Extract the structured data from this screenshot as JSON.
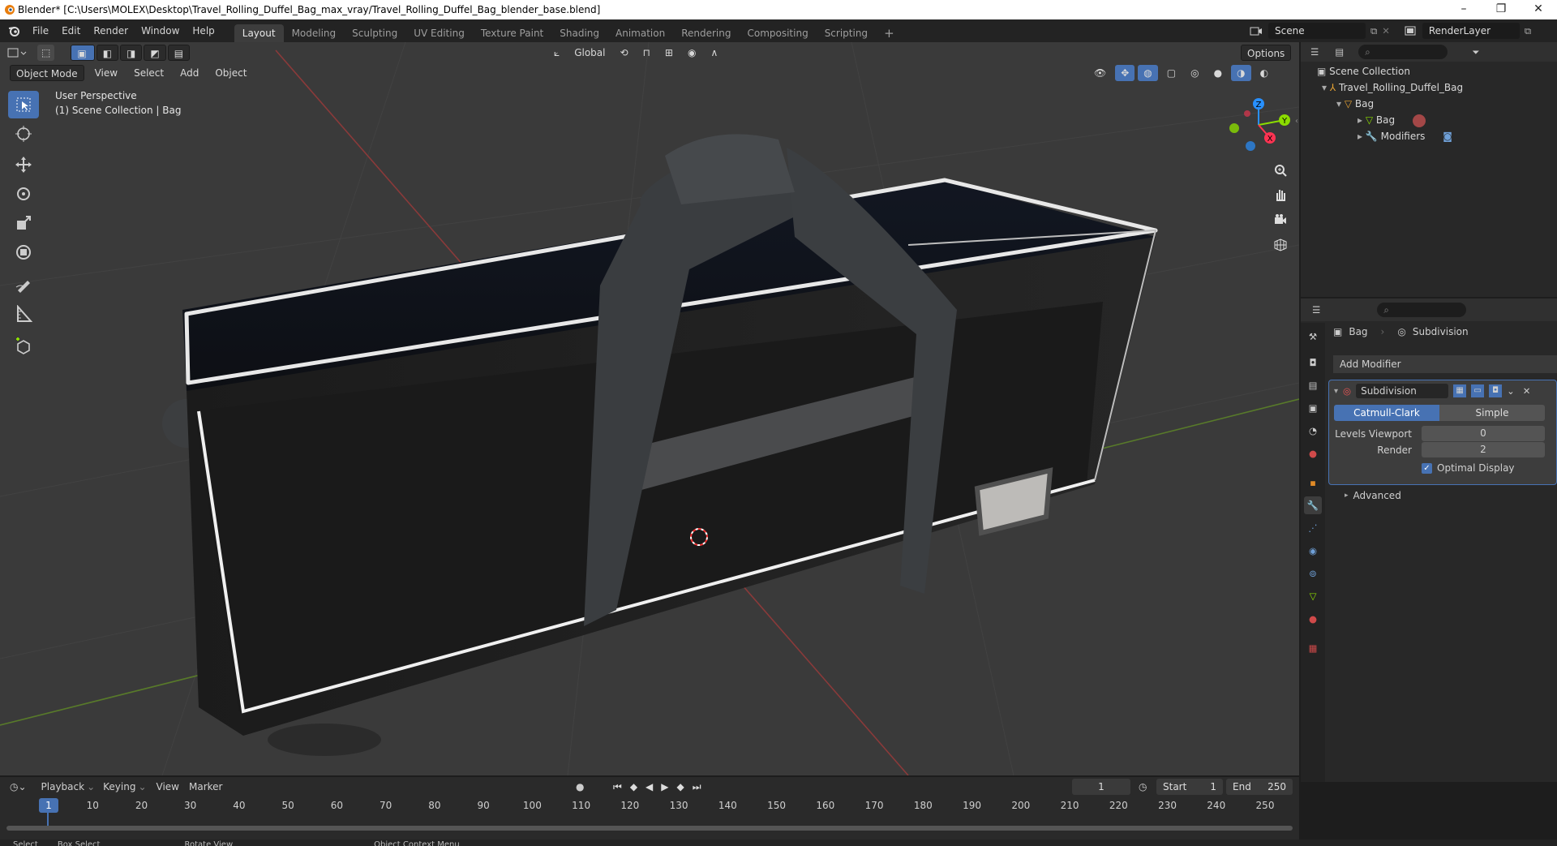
{
  "window": {
    "title": "Blender* [C:\\Users\\MOLEX\\Desktop\\Travel_Rolling_Duffel_Bag_max_vray/Travel_Rolling_Duffel_Bag_blender_base.blend]",
    "minimize": "–",
    "restore": "❐",
    "close": "✕"
  },
  "menu": [
    "File",
    "Edit",
    "Render",
    "Window",
    "Help"
  ],
  "workspaces": [
    "Layout",
    "Modeling",
    "Sculpting",
    "UV Editing",
    "Texture Paint",
    "Shading",
    "Animation",
    "Rendering",
    "Compositing",
    "Scripting"
  ],
  "workspace_add": "+",
  "scene": {
    "scene_name": "Scene",
    "view_layer": "RenderLayer"
  },
  "viewport": {
    "mode": "Object Mode",
    "menus": [
      "View",
      "Select",
      "Add",
      "Object"
    ],
    "transform_orientation": "Global",
    "options": "Options",
    "overlay_title": "User Perspective",
    "overlay_subtitle": "(1) Scene Collection | Bag",
    "gizmo_axes": [
      "X",
      "Y",
      "Z"
    ]
  },
  "outliner": {
    "rows": [
      {
        "label": "Scene Collection",
        "icon": "collection-icon"
      },
      {
        "label": "Travel_Rolling_Duffel_Bag",
        "icon": "empty-icon"
      },
      {
        "label": "Bag",
        "icon": "object-icon"
      },
      {
        "label": "Bag",
        "icon": "mesh-icon"
      },
      {
        "label": "Modifiers",
        "icon": "wrench-icon"
      }
    ]
  },
  "properties": {
    "breadcrumb_object": "Bag",
    "breadcrumb_modifier": "Subdivision",
    "add_modifier": "Add Modifier",
    "modifier_name": "Subdivision",
    "type_options": [
      "Catmull-Clark",
      "Simple"
    ],
    "selected_type": "Catmull-Clark",
    "fields": [
      {
        "label": "Levels Viewport",
        "value": "0"
      },
      {
        "label": "Render",
        "value": "2"
      }
    ],
    "optimal_display": "Optimal Display",
    "optimal_display_checked": true,
    "advanced": "Advanced"
  },
  "timeline": {
    "menus": [
      "Playback",
      "Keying",
      "View",
      "Marker"
    ],
    "current_frame": "1",
    "start_label": "Start",
    "start": "1",
    "end_label": "End",
    "end": "250",
    "ticks": [
      "1",
      "10",
      "20",
      "30",
      "40",
      "50",
      "60",
      "70",
      "80",
      "90",
      "100",
      "110",
      "120",
      "130",
      "140",
      "150",
      "160",
      "170",
      "180",
      "190",
      "200",
      "210",
      "220",
      "230",
      "240",
      "250"
    ]
  },
  "status": [
    "Select",
    "Box Select",
    "Rotate View",
    "Object Context Menu"
  ],
  "colors": {
    "accent": "#4772b3",
    "viewport_bg": "#3a3a3a",
    "panel_bg": "#282828",
    "axis_x": "#ff3352",
    "axis_y": "#8bdc00",
    "axis_z": "#2890ff"
  }
}
